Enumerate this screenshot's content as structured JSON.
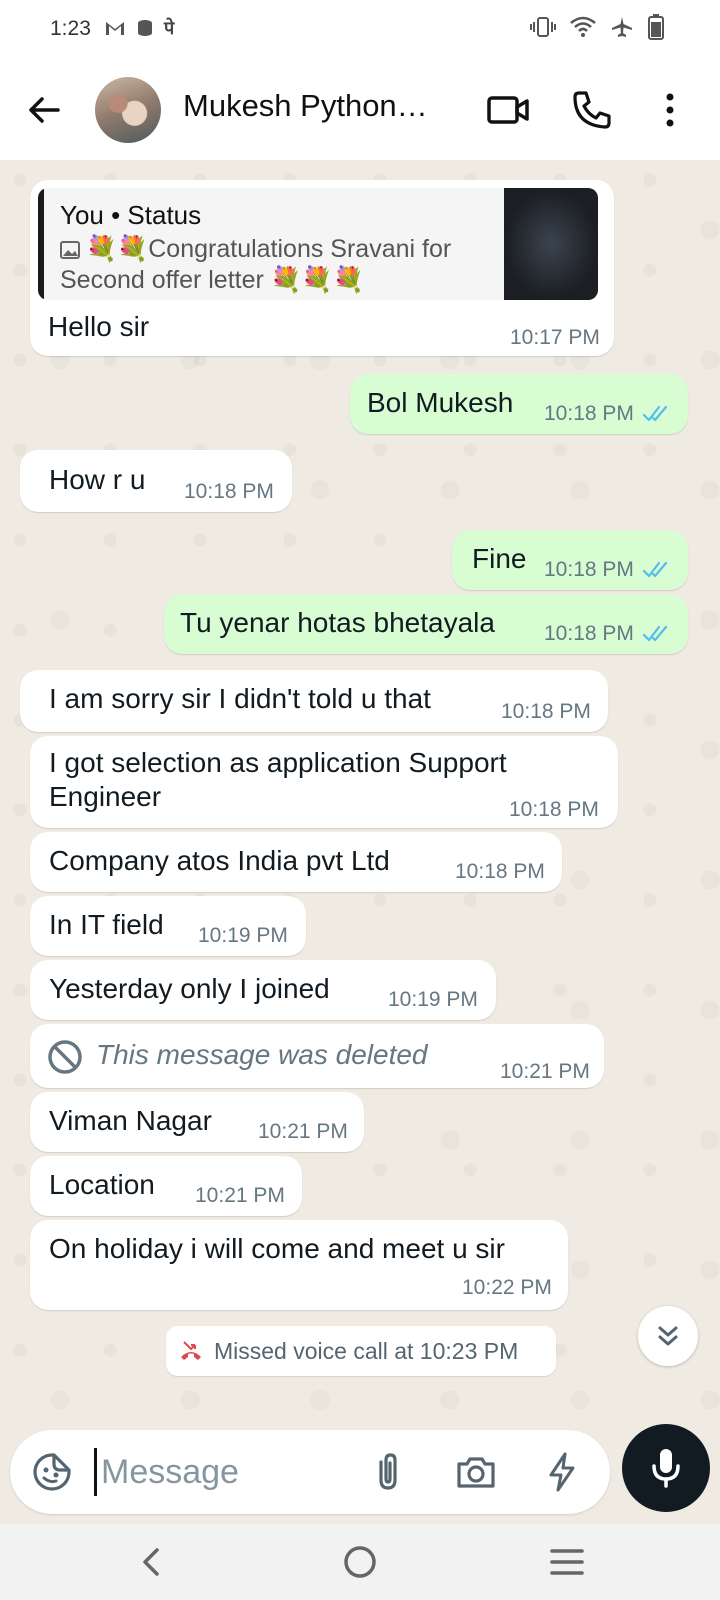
{
  "status_bar": {
    "time": "1:23",
    "left_icons": [
      "gmail-icon",
      "storage-icon",
      "hindi-letter-icon"
    ],
    "hindi_letter": "पे",
    "right_icons": [
      "vibrate-icon",
      "wifi-icon",
      "airplane-icon",
      "battery-icon"
    ]
  },
  "header": {
    "contact_name": "Mukesh Python…",
    "icons": [
      "back-arrow-icon",
      "video-call-icon",
      "voice-call-icon",
      "more-options-icon"
    ]
  },
  "colors": {
    "outgoing_bubble": "#d9fdd3",
    "incoming_bubble": "#ffffff",
    "read_ticks": "#53bdeb",
    "missed_call": "#e0474c",
    "chat_background": "#efeae2"
  },
  "messages": [
    {
      "direction": "in",
      "quote": {
        "title": "You • Status",
        "body": "💐💐Congratulations Sravani for Second offer letter 💐💐💐"
      },
      "text": "Hello sir",
      "time": "10:17 PM"
    },
    {
      "direction": "out",
      "text": "Bol Mukesh",
      "time": "10:18 PM"
    },
    {
      "direction": "in",
      "text": "How r u",
      "time": "10:18 PM"
    },
    {
      "direction": "out",
      "text": "Fine",
      "time": "10:18 PM"
    },
    {
      "direction": "out",
      "text": "Tu yenar hotas bhetayala",
      "time": "10:18 PM"
    },
    {
      "direction": "in",
      "text": "I am sorry sir I didn't told u that",
      "time": "10:18 PM"
    },
    {
      "direction": "in",
      "text_line1": "I got selection as application Support",
      "text_line2": "Engineer",
      "time": "10:18 PM"
    },
    {
      "direction": "in",
      "text": "Company atos India pvt Ltd",
      "time": "10:18 PM"
    },
    {
      "direction": "in",
      "text": "In IT field",
      "time": "10:19 PM"
    },
    {
      "direction": "in",
      "text": "Yesterday only I joined",
      "time": "10:19 PM"
    },
    {
      "direction": "in",
      "deleted": true,
      "text": "This message was deleted",
      "time": "10:21 PM"
    },
    {
      "direction": "in",
      "text": "Viman Nagar",
      "time": "10:21 PM"
    },
    {
      "direction": "in",
      "text": "Location",
      "time": "10:21 PM"
    },
    {
      "direction": "in",
      "text": "On holiday i will come and meet u sir",
      "time": "10:22 PM"
    }
  ],
  "system": {
    "missed_call": "Missed voice call at 10:23 PM"
  },
  "composer": {
    "placeholder": "Message",
    "icons": [
      "sticker-icon",
      "attach-icon",
      "camera-icon",
      "lightning-icon",
      "mic-icon"
    ]
  },
  "navigation": {
    "icons": [
      "nav-back-icon",
      "nav-home-icon",
      "nav-recents-icon"
    ]
  }
}
